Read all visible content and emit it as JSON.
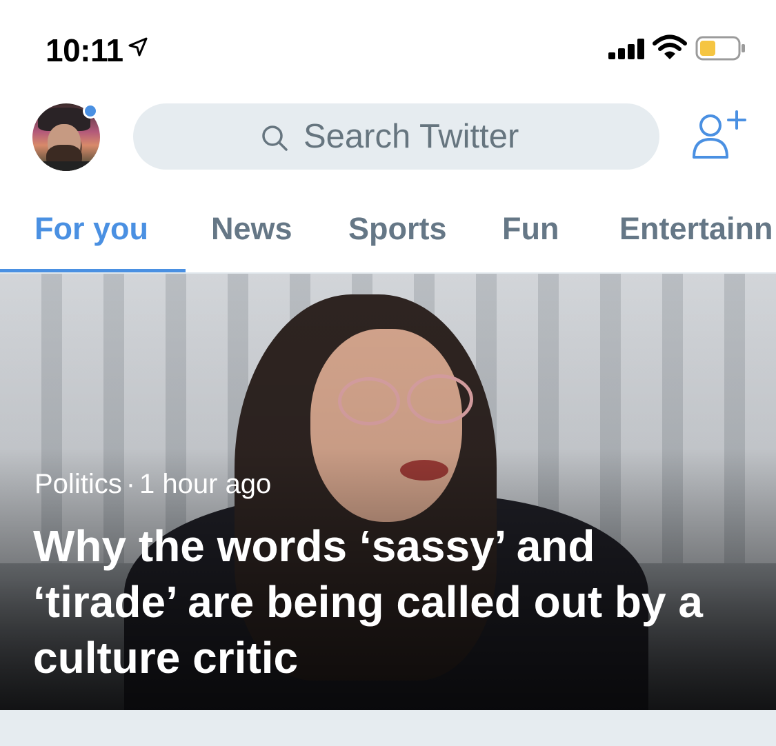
{
  "status_bar": {
    "time": "10:11",
    "icons": [
      "location-arrow-icon",
      "cellular-signal-icon",
      "wifi-icon",
      "battery-icon"
    ],
    "battery_color": "#f5c542"
  },
  "header": {
    "avatar_has_notification": true,
    "search_placeholder": "Search Twitter",
    "accent_color": "#4a90e2"
  },
  "tabs": [
    {
      "label": "For you",
      "active": true
    },
    {
      "label": "News",
      "active": false
    },
    {
      "label": "Sports",
      "active": false
    },
    {
      "label": "Fun",
      "active": false
    },
    {
      "label": "Entertainn",
      "active": false
    }
  ],
  "hero": {
    "category": "Politics",
    "separator": "·",
    "time_ago": "1 hour ago",
    "headline": "Why the words ‘sassy’ and ‘tirade’ are being called out by a culture critic"
  }
}
